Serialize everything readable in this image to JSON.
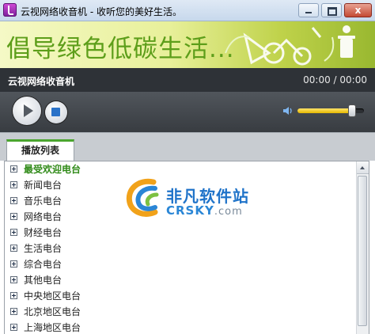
{
  "window": {
    "title": "云视网络收音机 - 收听您的美好生活。",
    "close_symbol": "x"
  },
  "banner": {
    "text": "倡导绿色低碳生活..."
  },
  "player": {
    "title": "云视网络收音机",
    "time": "00:00 / 00:00",
    "volume_level": 0.82
  },
  "tabs": [
    {
      "label": "播放列表",
      "active": true
    }
  ],
  "list": {
    "items": [
      {
        "label": "最受欢迎电台",
        "highlight": true
      },
      {
        "label": "新闻电台"
      },
      {
        "label": "音乐电台"
      },
      {
        "label": "网络电台"
      },
      {
        "label": "财经电台"
      },
      {
        "label": "生活电台"
      },
      {
        "label": "综合电台"
      },
      {
        "label": "其他电台"
      },
      {
        "label": "中央地区电台"
      },
      {
        "label": "北京地区电台"
      },
      {
        "label": "上海地区电台"
      }
    ]
  },
  "watermark": {
    "cn": "非凡软件站",
    "en": "CRSKY",
    "en_suffix": ".com"
  },
  "colors": {
    "accent_green": "#4aa52e",
    "banner_text": "#5d9e1a",
    "player_bg": "#2e3237",
    "volume_fill": "#e6b800",
    "stop_blue": "#2a72c8"
  }
}
